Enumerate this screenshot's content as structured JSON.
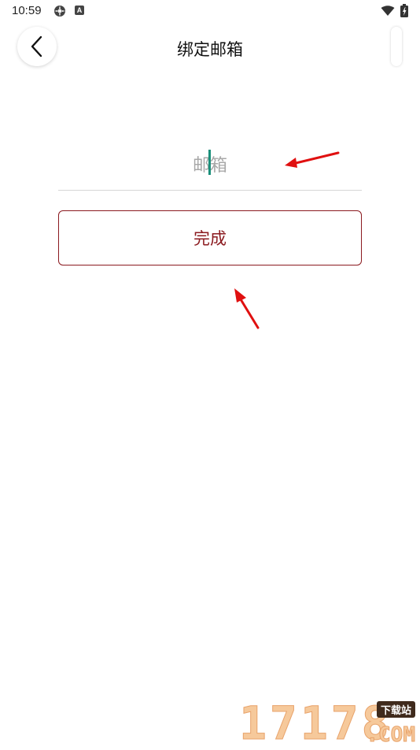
{
  "status_bar": {
    "time": "10:59",
    "icons": [
      "settings-icon",
      "a-icon",
      "wifi-icon",
      "battery-icon"
    ],
    "a_icon_label": "A"
  },
  "header": {
    "title": "绑定邮箱",
    "back_icon": "chevron-left-icon"
  },
  "form": {
    "email_placeholder": "邮箱",
    "email_value": "",
    "done_label": "完成"
  },
  "colors": {
    "accent": "#8b1a1f",
    "caret": "#1a8f7a",
    "annotation_arrow": "#e01010"
  },
  "watermark": {
    "digits": "17178",
    "badge": "下载站",
    "suffix": ".COM"
  }
}
